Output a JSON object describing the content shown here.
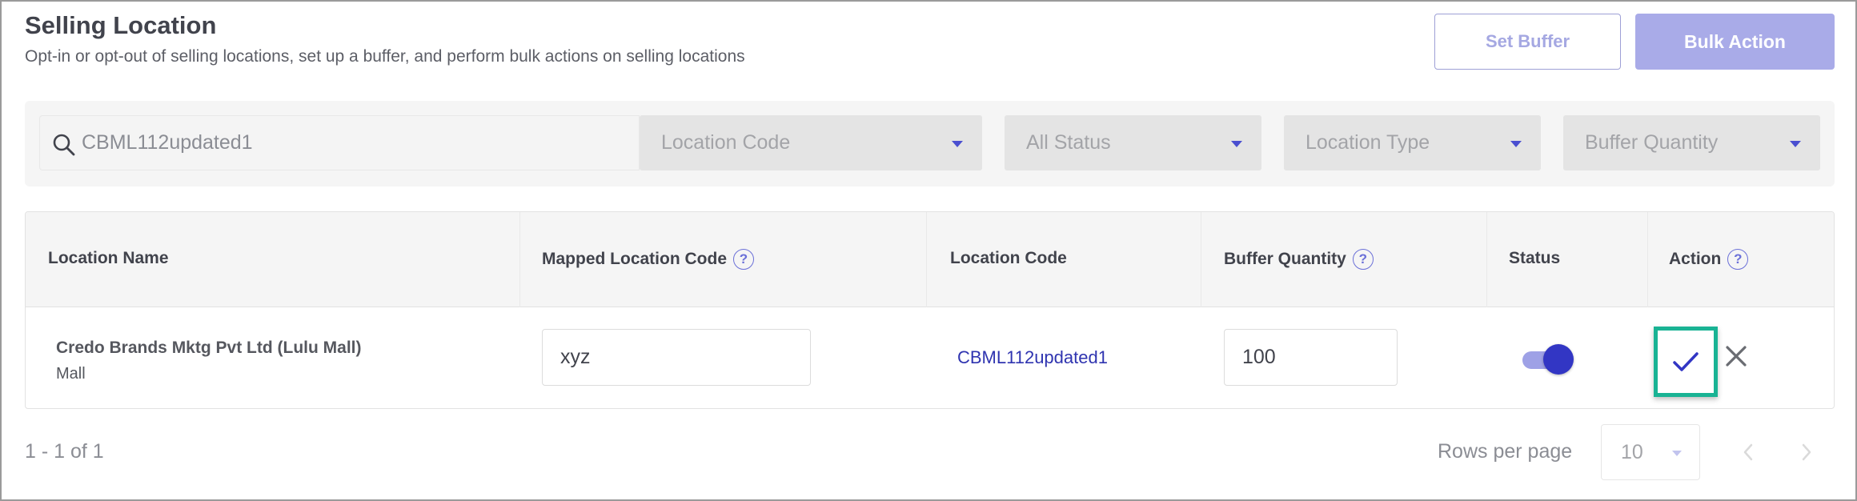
{
  "header": {
    "title": "Selling Location",
    "subtitle": "Opt-in or opt-out of selling locations, set up a buffer, and perform bulk actions on selling locations",
    "set_buffer_label": "Set Buffer",
    "bulk_action_label": "Bulk Action"
  },
  "filters": {
    "search_value": "CBML112updated1",
    "location_code": "Location Code",
    "status": "All Status",
    "location_type": "Location Type",
    "buffer_quantity": "Buffer Quantity"
  },
  "table": {
    "columns": {
      "location_name": "Location Name",
      "mapped_location_code": "Mapped Location Code",
      "location_code": "Location Code",
      "buffer_quantity": "Buffer Quantity",
      "status": "Status",
      "action": "Action"
    },
    "rows": [
      {
        "location_name": "Credo Brands Mktg Pvt Ltd (Lulu Mall)",
        "location_type": "Mall",
        "mapped_location_code": "xyz",
        "location_code": "CBML112updated1",
        "buffer_quantity": "100",
        "status_enabled": true
      }
    ]
  },
  "pagination": {
    "range": "1 - 1 of 1",
    "rows_per_page_label": "Rows per page",
    "rows_per_page_value": "10"
  },
  "icons": {
    "search": "search-icon",
    "help": "help-icon",
    "check": "check-icon",
    "close": "close-icon",
    "chevron_left": "chevron-left-icon",
    "chevron_right": "chevron-right-icon"
  },
  "colors": {
    "accent": "#3236c4",
    "highlight": "#19b394",
    "link": "#2f34b0"
  }
}
